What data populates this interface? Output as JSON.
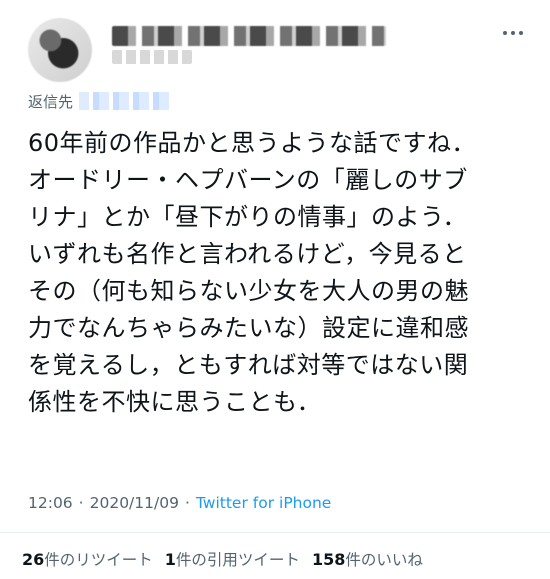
{
  "tweet": {
    "reply_label": "返信先",
    "text": "60年前の作品かと思うような話ですね．\nオードリー・ヘプバーンの「麗しのサブ\nリナ」とか「昼下がりの情事」のよう．\nいずれも名作と言われるけど，今見ると\nその（何も知らない少女を大人の男の魅\n力でなんちゃらみたいな）設定に違和感\nを覚えるし，ともすれば対等ではない関\n係性を不快に思うことも．",
    "time": "12:06",
    "date": "2020/11/09",
    "separator": "·",
    "source": "Twitter for iPhone"
  },
  "stats": {
    "retweets": {
      "count": "26",
      "label": "件のリツイート"
    },
    "quotes": {
      "count": "1",
      "label": "件の引用ツイート"
    },
    "likes": {
      "count": "158",
      "label": "件のいいね"
    }
  },
  "colors": {
    "text": "#0f1419",
    "secondary": "#536471",
    "link": "#1d9bf0",
    "divider": "#e6ecf0"
  }
}
